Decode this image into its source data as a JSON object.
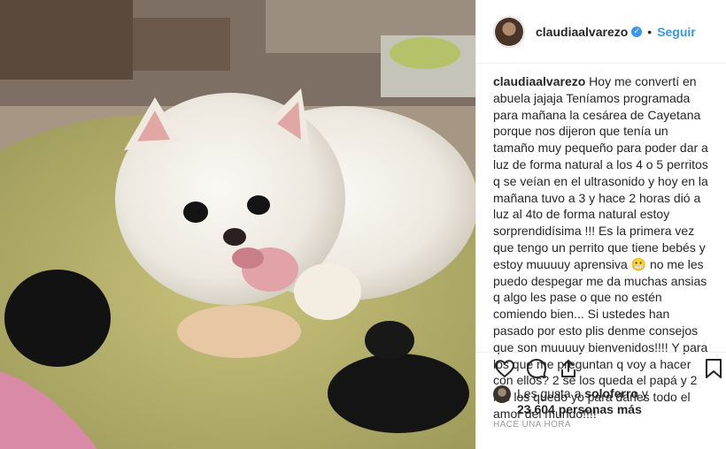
{
  "post": {
    "username": "claudiaalvarezo",
    "follow_label": "Seguir",
    "separator": "•",
    "verified_glyph": "✓"
  },
  "caption": {
    "username": "claudiaalvarezo",
    "text": "Hoy me convertí en abuela jajaja Teníamos programada para mañana la cesárea de Cayetana porque nos dijeron que tenía un tamaño muy pequeño para poder dar a luz de forma natural a los 4 o 5 perritos q se veían en el ultrasonido y hoy en la mañana tuvo a 3 y hace 2 horas dió a luz al 4to de forma natural estoy sorprendidísima !!! Es la primera vez que tengo un perrito que tiene bebés y estoy muuuuy aprensiva 😬 no me les puedo despegar me da muchas ansias q algo les pase o que no estén comiendo bien... Si ustedes han pasado por esto plis denme consejos que son muuuuy bienvenidos!!!! Y para los que me preguntan q voy a hacer con ellos? 2 se los queda el papá y 2 me los quedo yo para darles todo el amor del mundo!!!!"
  },
  "likes": {
    "prefix": "Les gusta a",
    "liker": "soloferro",
    "suffix": "y",
    "count_text": "23.604 personas más"
  },
  "timestamp": "HACE UNA HORA",
  "icons": {
    "like": "heart-icon",
    "comment": "comment-icon",
    "share": "share-icon",
    "save": "bookmark-icon"
  },
  "colors": {
    "link_blue": "#3897f0",
    "text": "#262626",
    "muted": "#999999",
    "divider": "#efefef"
  }
}
